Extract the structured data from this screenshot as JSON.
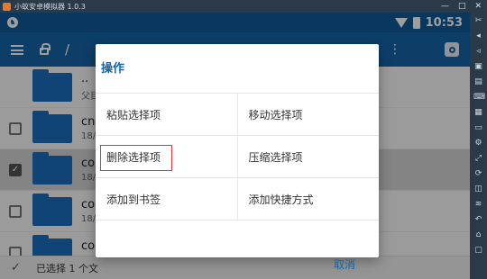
{
  "window": {
    "title": "小蚁安卓模拟器 1.0.3",
    "controls": [
      "—",
      "□",
      "✕"
    ]
  },
  "statusbar": {
    "time": "10:53",
    "notif_glyph": "♞"
  },
  "toolbar": {
    "path": "/",
    "more_glyph": "⋮"
  },
  "files": [
    {
      "name": "..",
      "sub": "父目",
      "checkbox": "none",
      "selected": false
    },
    {
      "name": "cn.a",
      "sub": "18/4",
      "checkbox": "off",
      "selected": false
    },
    {
      "name": "com",
      "sub": "18/4",
      "checkbox": "on",
      "selected": true
    },
    {
      "name": "com",
      "sub": "18/4",
      "checkbox": "off",
      "selected": false
    },
    {
      "name": "com",
      "sub": "18/4",
      "checkbox": "off",
      "selected": false
    }
  ],
  "bottombar": {
    "text": "已选择 1 个文"
  },
  "dialog": {
    "title": "操作",
    "rows": [
      [
        "粘贴选择项",
        "移动选择项"
      ],
      [
        "删除选择项",
        "压缩选择项"
      ],
      [
        "添加到书签",
        "添加快捷方式"
      ]
    ],
    "highlighted": "删除选择项",
    "cancel": "取消"
  },
  "sidebar_icons": [
    "scissors-icon",
    "volume-up-icon",
    "volume-down-icon",
    "camera-icon",
    "screenshot-icon",
    "keyboard-icon",
    "apk-icon",
    "folder-icon",
    "settings-icon",
    "fullscreen-icon",
    "rotate-icon",
    "multi-window-icon",
    "shake-icon",
    "back-icon",
    "home-icon",
    "recent-apps-icon"
  ],
  "colors": {
    "primary": "#1565a8",
    "statusbar": "#0f5a96",
    "highlight_border": "#d43b3b"
  }
}
